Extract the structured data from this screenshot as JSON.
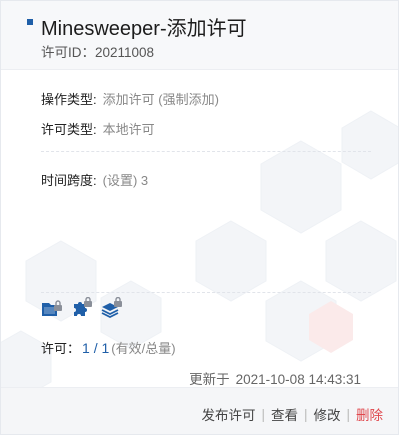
{
  "header": {
    "title": "Minesweeper-添加许可",
    "license_id_label": "许可ID：",
    "license_id": "20211008"
  },
  "details": {
    "op_type_label": "操作类型:",
    "op_type_value": "添加许可 (强制添加)",
    "license_type_label": "许可类型:",
    "license_type_value": "本地许可",
    "time_span_label": "时间跨度:",
    "time_span_value": "(设置) 3"
  },
  "icons": [
    "folder-lock-icon",
    "puzzle-lock-icon",
    "layers-lock-icon"
  ],
  "colors": {
    "accent": "#1f5fa8",
    "danger": "#e0474c"
  },
  "count": {
    "label": "许可：",
    "value": "1 / 1",
    "hint": "(有效/总量)"
  },
  "updated": {
    "label": "更新于",
    "timestamp": "2021-10-08 14:43:31"
  },
  "actions": {
    "publish": "发布许可",
    "view": "查看",
    "edit": "修改",
    "delete": "删除",
    "separator": "|"
  }
}
